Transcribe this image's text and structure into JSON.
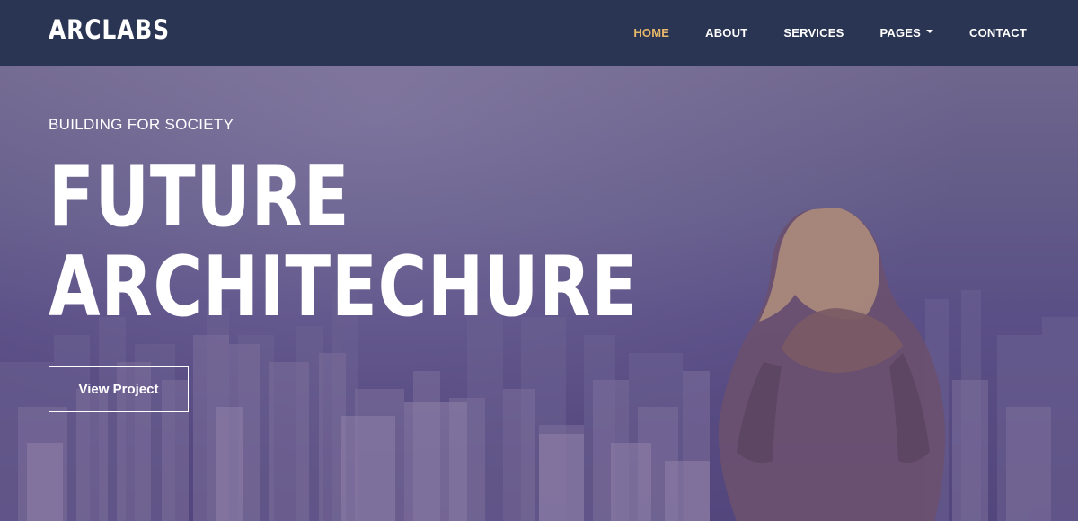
{
  "brand": {
    "name": "ARCLABS"
  },
  "nav": {
    "items": [
      {
        "label": "HOME",
        "active": true
      },
      {
        "label": "ABOUT"
      },
      {
        "label": "SERVICES"
      },
      {
        "label": "PAGES",
        "dropdown": true
      },
      {
        "label": "CONTACT"
      }
    ]
  },
  "hero": {
    "eyebrow": "BUILDING FOR SOCIETY",
    "headline_line1": "FUTURE",
    "headline_line2": "ARCHITECHURE",
    "cta_label": "View Project"
  },
  "colors": {
    "navbar_bg": "#2a3553",
    "accent_active": "#e6b86a",
    "hero_overlay": "#5a4f86",
    "text": "#ffffff"
  }
}
